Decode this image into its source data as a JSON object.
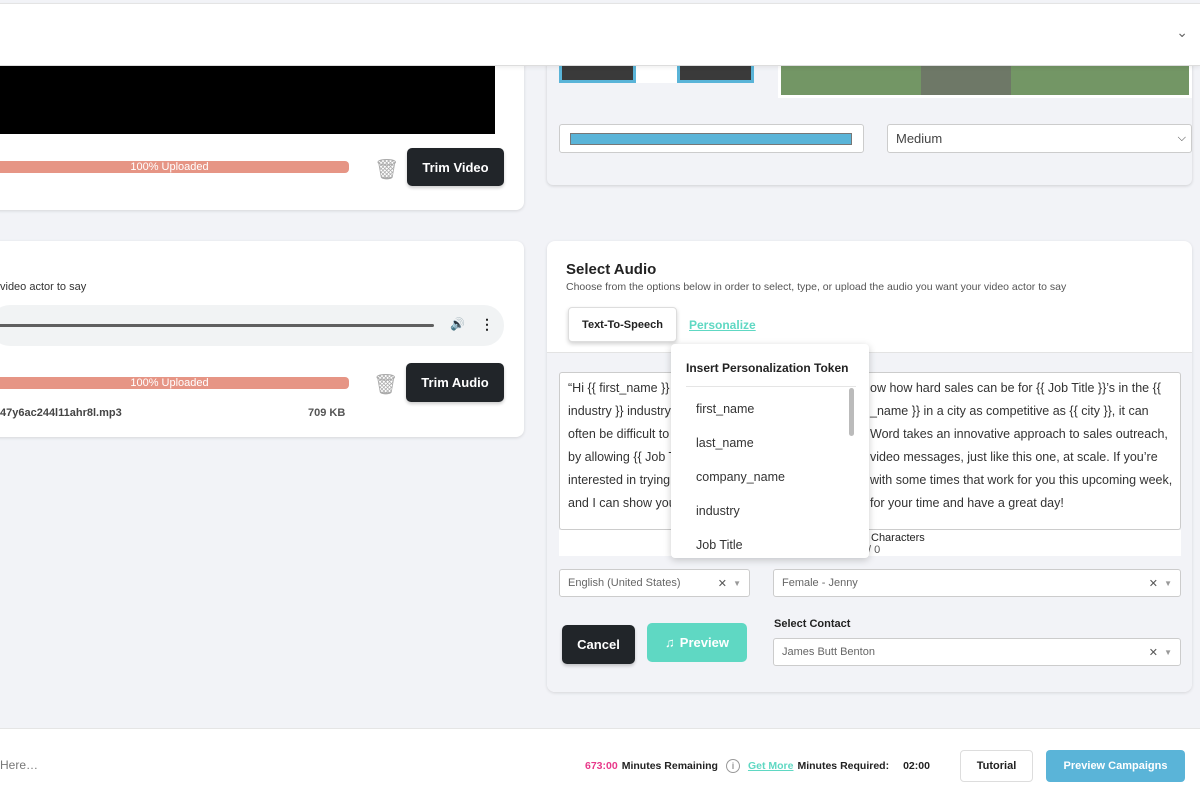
{
  "top": {
    "chevron_icon": "chevron-down"
  },
  "video": {
    "progress_label": "100% Uploaded",
    "progress_pct": 100,
    "trim_label": "Trim Video"
  },
  "quality": {
    "selected": "Medium"
  },
  "audio_left": {
    "subtitle_fragment": "video actor to say",
    "progress_label": "100% Uploaded",
    "progress_pct": 100,
    "trim_label": "Trim Audio",
    "filename": "47y6ac244l11ahr8l.mp3",
    "filesize": "709 KB"
  },
  "select_audio": {
    "title": "Select Audio",
    "subtitle": "Choose from the options below in order to select, type, or upload the audio you want your video actor to say",
    "tabs": [
      {
        "label": "Text-To-Speech",
        "active": true
      },
      {
        "label": "Personalize",
        "active": false
      }
    ],
    "text_lines_left": [
      "“Hi {{ first_name }}",
      "industry }} industry",
      "often be difficult to",
      "by allowing {{ Job T",
      "interested in trying",
      "and I can show you"
    ],
    "text_lines_right": [
      "ow how hard sales can be for {{ Job Title }}’s in the {{",
      "_name }} in a city as competitive as {{ city }}, it can",
      "Word takes an innovative approach to sales outreach,",
      "video messages, just like this one, at scale. If you’re",
      "with some times that work for you this upcoming week,",
      "for your time and have a great day!"
    ],
    "characters_label": "Characters",
    "characters_count": "/ 0",
    "language": "English (United States)",
    "voice": "Female - Jenny",
    "cancel_label": "Cancel",
    "preview_label": "Preview",
    "contact_label": "Select Contact",
    "contact": "James Butt Benton"
  },
  "token_menu": {
    "title": "Insert Personalization Token",
    "items": [
      "first_name",
      "last_name",
      "company_name",
      "industry",
      "Job Title"
    ]
  },
  "footer": {
    "input_placeholder": "Here…",
    "minutes_remaining_value": "673:00",
    "minutes_remaining_label": "Minutes Remaining",
    "get_more": "Get More",
    "minutes_required_label": "Minutes Required:",
    "minutes_required_value": "02:00",
    "tutorial": "Tutorial",
    "preview_campaigns": "Preview Campaigns"
  },
  "colors": {
    "accent_teal": "#5fd8c3",
    "progress": "#e69585",
    "blue": "#5ab4d8",
    "pink": "#e8388a"
  }
}
